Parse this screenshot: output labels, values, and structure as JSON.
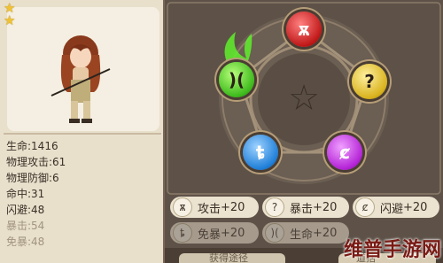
{
  "hero": {
    "stars": [
      "★",
      "★"
    ],
    "stats": [
      {
        "text": "生命:1416",
        "dim": false
      },
      {
        "text": "物理攻击:61",
        "dim": false
      },
      {
        "text": "物理防御:6",
        "dim": false
      },
      {
        "text": "命中:31",
        "dim": false
      },
      {
        "text": "闪避:48",
        "dim": false
      },
      {
        "text": "暴击:54",
        "dim": true
      },
      {
        "text": "免暴:48",
        "dim": true
      }
    ]
  },
  "runes": [
    {
      "color": "red",
      "symbol": "ѫ"
    },
    {
      "color": "green",
      "symbol": ")("
    },
    {
      "color": "yellow",
      "symbol": "?"
    },
    {
      "color": "blue",
      "symbol": "ȶ"
    },
    {
      "color": "purple",
      "symbol": "ȼ"
    }
  ],
  "center_symbol": "☆",
  "bonuses": [
    {
      "icon": "ѫ",
      "label": "攻击",
      "value": "+20"
    },
    {
      "icon": "?",
      "label": "暴击",
      "value": "+20"
    },
    {
      "icon": "ȼ",
      "label": "闪避",
      "value": "+20"
    },
    {
      "icon": "ȶ",
      "label": "免暴",
      "value": "+20"
    },
    {
      "icon": ")(",
      "label": "生命",
      "value": "+20"
    }
  ],
  "bottom": {
    "left_text": "获得途径",
    "right_text": "道括"
  },
  "watermark": "维普手游网"
}
